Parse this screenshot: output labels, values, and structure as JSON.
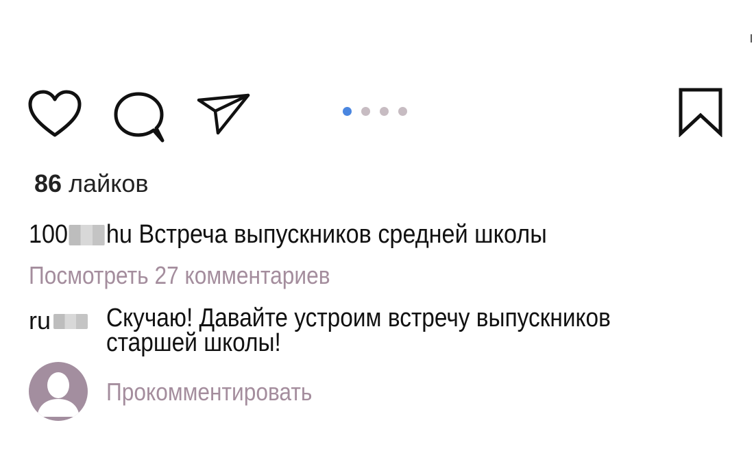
{
  "actions": {
    "like_icon": "heart-icon",
    "comment_icon": "speech-bubble-icon",
    "share_icon": "paper-plane-icon",
    "save_icon": "bookmark-icon"
  },
  "carousel": {
    "count": 4,
    "active_index": 0,
    "active_color": "#4a86e0",
    "inactive_color": "#c7bcc2"
  },
  "likes": {
    "count": "86",
    "label": "лайков"
  },
  "caption": {
    "username_start": "100",
    "username_end": "hu",
    "text": "Встреча выпускников средней школы"
  },
  "view_comments_label": "Посмотреть 27 комментариев",
  "comment": {
    "username_start": "ru",
    "text": "Скучаю! Давайте устроим встречу выпускников старшей школы!"
  },
  "add_comment_placeholder": "Прокомментировать",
  "colors": {
    "muted_text": "#a48d9d",
    "avatar_bg": "#a38e9f"
  }
}
